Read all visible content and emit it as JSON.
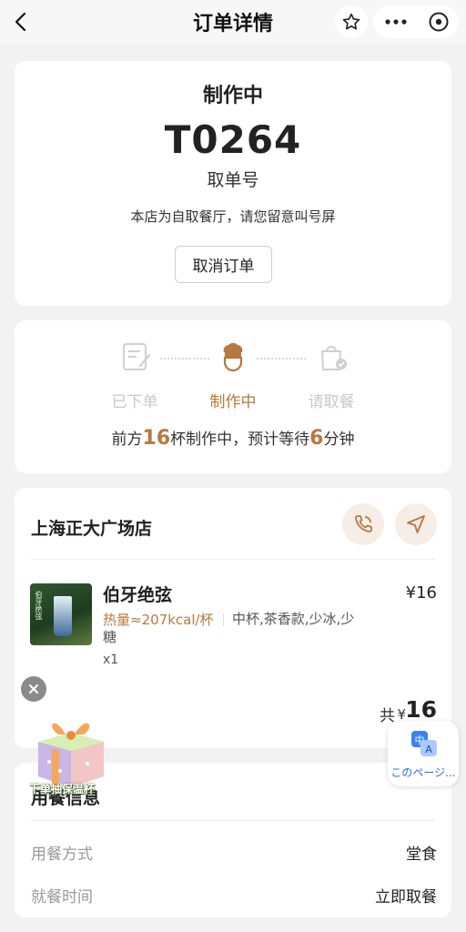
{
  "header": {
    "title": "订单详情"
  },
  "order": {
    "status": "制作中",
    "pickup_number": "T0264",
    "pickup_label": "取单号",
    "notice": "本店为自取餐厅，请您留意叫号屏",
    "cancel_label": "取消订单"
  },
  "progress": {
    "steps": [
      {
        "label": "已下单",
        "active": false
      },
      {
        "label": "制作中",
        "active": true
      },
      {
        "label": "请取餐",
        "active": false
      }
    ],
    "queue_prefix": "前方",
    "cups_ahead": "16",
    "queue_middle": "杯制作中，预计等待",
    "wait_minutes": "6",
    "queue_suffix": "分钟"
  },
  "store": {
    "name": "上海正大广场店"
  },
  "item": {
    "name": "伯牙绝弦",
    "price": "¥16",
    "calories": "热量≈207kcal/杯",
    "options": "中杯,茶香款,少冰,少糖",
    "quantity": "x1",
    "thumb_text": "伯牙绝弦"
  },
  "total": {
    "label": "共",
    "currency": "¥",
    "amount": "16"
  },
  "dining": {
    "title": "用餐信息",
    "rows": [
      {
        "label": "用餐方式",
        "value": "堂食"
      },
      {
        "label": "就餐时间",
        "value": "立即取餐"
      }
    ]
  },
  "promo": {
    "caption": "下单抽保温杯"
  },
  "translate": {
    "label": "このページ..."
  },
  "colors": {
    "accent": "#b6793f",
    "background": "#f2f2f2",
    "link": "#2d6cdf"
  }
}
